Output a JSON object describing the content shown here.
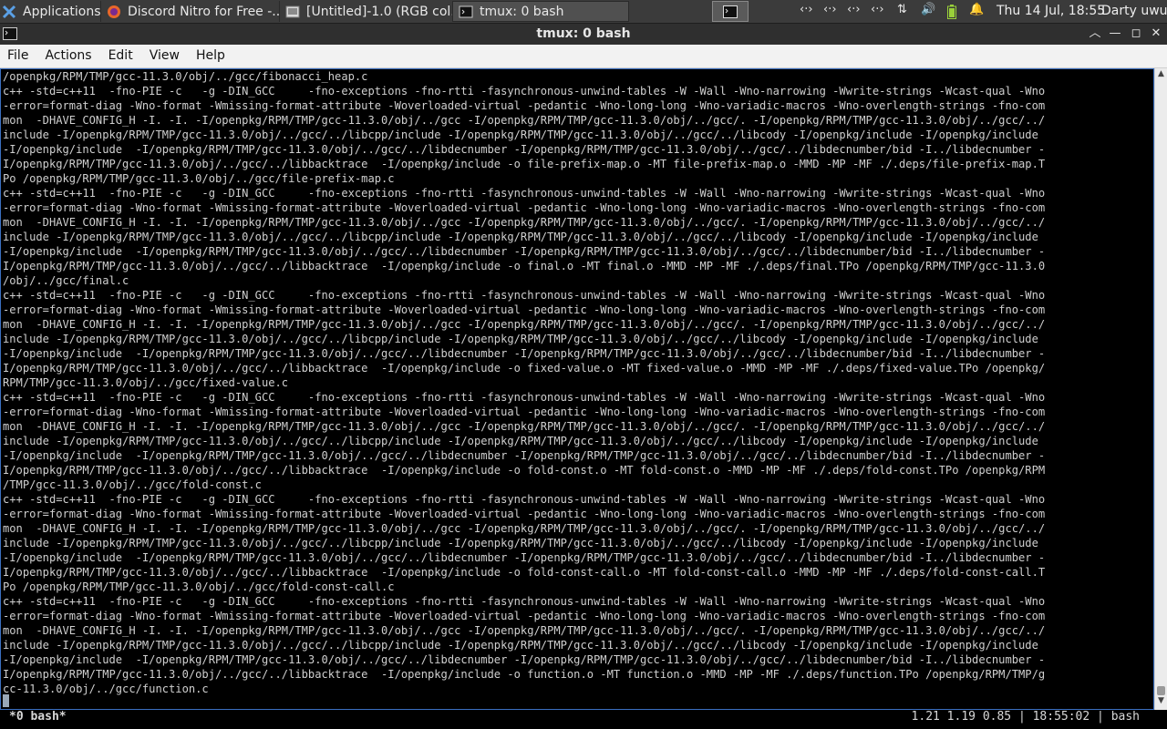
{
  "panel": {
    "apps_label": "Applications",
    "tasks": [
      {
        "label": "Discord Nitro for Free -..."
      },
      {
        "label": "[Untitled]-1.0 (RGB col..."
      },
      {
        "label": "tmux: 0 bash"
      }
    ],
    "tray_icons": [
      "network-icon",
      "network-icon",
      "network-icon",
      "network-icon",
      "transfer-icon",
      "volume-icon",
      "battery-icon",
      "bell-icon"
    ],
    "clock": "Thu 14 Jul, 18:55",
    "user": "Darty uwu"
  },
  "window": {
    "title": "tmux: 0 bash"
  },
  "menubar": {
    "items": [
      "File",
      "Actions",
      "Edit",
      "View",
      "Help"
    ]
  },
  "terminal": {
    "lines": [
      "/openpkg/RPM/TMP/gcc-11.3.0/obj/../gcc/fibonacci_heap.c",
      "c++ -std=c++11  -fno-PIE -c   -g -DIN_GCC     -fno-exceptions -fno-rtti -fasynchronous-unwind-tables -W -Wall -Wno-narrowing -Wwrite-strings -Wcast-qual -Wno",
      "-error=format-diag -Wno-format -Wmissing-format-attribute -Woverloaded-virtual -pedantic -Wno-long-long -Wno-variadic-macros -Wno-overlength-strings -fno-com",
      "mon  -DHAVE_CONFIG_H -I. -I. -I/openpkg/RPM/TMP/gcc-11.3.0/obj/../gcc -I/openpkg/RPM/TMP/gcc-11.3.0/obj/../gcc/. -I/openpkg/RPM/TMP/gcc-11.3.0/obj/../gcc/../",
      "include -I/openpkg/RPM/TMP/gcc-11.3.0/obj/../gcc/../libcpp/include -I/openpkg/RPM/TMP/gcc-11.3.0/obj/../gcc/../libcody -I/openpkg/include -I/openpkg/include",
      "-I/openpkg/include  -I/openpkg/RPM/TMP/gcc-11.3.0/obj/../gcc/../libdecnumber -I/openpkg/RPM/TMP/gcc-11.3.0/obj/../gcc/../libdecnumber/bid -I../libdecnumber -",
      "I/openpkg/RPM/TMP/gcc-11.3.0/obj/../gcc/../libbacktrace  -I/openpkg/include -o file-prefix-map.o -MT file-prefix-map.o -MMD -MP -MF ./.deps/file-prefix-map.T",
      "Po /openpkg/RPM/TMP/gcc-11.3.0/obj/../gcc/file-prefix-map.c",
      "c++ -std=c++11  -fno-PIE -c   -g -DIN_GCC     -fno-exceptions -fno-rtti -fasynchronous-unwind-tables -W -Wall -Wno-narrowing -Wwrite-strings -Wcast-qual -Wno",
      "-error=format-diag -Wno-format -Wmissing-format-attribute -Woverloaded-virtual -pedantic -Wno-long-long -Wno-variadic-macros -Wno-overlength-strings -fno-com",
      "mon  -DHAVE_CONFIG_H -I. -I. -I/openpkg/RPM/TMP/gcc-11.3.0/obj/../gcc -I/openpkg/RPM/TMP/gcc-11.3.0/obj/../gcc/. -I/openpkg/RPM/TMP/gcc-11.3.0/obj/../gcc/../",
      "include -I/openpkg/RPM/TMP/gcc-11.3.0/obj/../gcc/../libcpp/include -I/openpkg/RPM/TMP/gcc-11.3.0/obj/../gcc/../libcody -I/openpkg/include -I/openpkg/include",
      "-I/openpkg/include  -I/openpkg/RPM/TMP/gcc-11.3.0/obj/../gcc/../libdecnumber -I/openpkg/RPM/TMP/gcc-11.3.0/obj/../gcc/../libdecnumber/bid -I../libdecnumber -",
      "I/openpkg/RPM/TMP/gcc-11.3.0/obj/../gcc/../libbacktrace  -I/openpkg/include -o final.o -MT final.o -MMD -MP -MF ./.deps/final.TPo /openpkg/RPM/TMP/gcc-11.3.0",
      "/obj/../gcc/final.c",
      "c++ -std=c++11  -fno-PIE -c   -g -DIN_GCC     -fno-exceptions -fno-rtti -fasynchronous-unwind-tables -W -Wall -Wno-narrowing -Wwrite-strings -Wcast-qual -Wno",
      "-error=format-diag -Wno-format -Wmissing-format-attribute -Woverloaded-virtual -pedantic -Wno-long-long -Wno-variadic-macros -Wno-overlength-strings -fno-com",
      "mon  -DHAVE_CONFIG_H -I. -I. -I/openpkg/RPM/TMP/gcc-11.3.0/obj/../gcc -I/openpkg/RPM/TMP/gcc-11.3.0/obj/../gcc/. -I/openpkg/RPM/TMP/gcc-11.3.0/obj/../gcc/../",
      "include -I/openpkg/RPM/TMP/gcc-11.3.0/obj/../gcc/../libcpp/include -I/openpkg/RPM/TMP/gcc-11.3.0/obj/../gcc/../libcody -I/openpkg/include -I/openpkg/include",
      "-I/openpkg/include  -I/openpkg/RPM/TMP/gcc-11.3.0/obj/../gcc/../libdecnumber -I/openpkg/RPM/TMP/gcc-11.3.0/obj/../gcc/../libdecnumber/bid -I../libdecnumber -",
      "I/openpkg/RPM/TMP/gcc-11.3.0/obj/../gcc/../libbacktrace  -I/openpkg/include -o fixed-value.o -MT fixed-value.o -MMD -MP -MF ./.deps/fixed-value.TPo /openpkg/",
      "RPM/TMP/gcc-11.3.0/obj/../gcc/fixed-value.c",
      "c++ -std=c++11  -fno-PIE -c   -g -DIN_GCC     -fno-exceptions -fno-rtti -fasynchronous-unwind-tables -W -Wall -Wno-narrowing -Wwrite-strings -Wcast-qual -Wno",
      "-error=format-diag -Wno-format -Wmissing-format-attribute -Woverloaded-virtual -pedantic -Wno-long-long -Wno-variadic-macros -Wno-overlength-strings -fno-com",
      "mon  -DHAVE_CONFIG_H -I. -I. -I/openpkg/RPM/TMP/gcc-11.3.0/obj/../gcc -I/openpkg/RPM/TMP/gcc-11.3.0/obj/../gcc/. -I/openpkg/RPM/TMP/gcc-11.3.0/obj/../gcc/../",
      "include -I/openpkg/RPM/TMP/gcc-11.3.0/obj/../gcc/../libcpp/include -I/openpkg/RPM/TMP/gcc-11.3.0/obj/../gcc/../libcody -I/openpkg/include -I/openpkg/include",
      "-I/openpkg/include  -I/openpkg/RPM/TMP/gcc-11.3.0/obj/../gcc/../libdecnumber -I/openpkg/RPM/TMP/gcc-11.3.0/obj/../gcc/../libdecnumber/bid -I../libdecnumber -",
      "I/openpkg/RPM/TMP/gcc-11.3.0/obj/../gcc/../libbacktrace  -I/openpkg/include -o fold-const.o -MT fold-const.o -MMD -MP -MF ./.deps/fold-const.TPo /openpkg/RPM",
      "/TMP/gcc-11.3.0/obj/../gcc/fold-const.c",
      "c++ -std=c++11  -fno-PIE -c   -g -DIN_GCC     -fno-exceptions -fno-rtti -fasynchronous-unwind-tables -W -Wall -Wno-narrowing -Wwrite-strings -Wcast-qual -Wno",
      "-error=format-diag -Wno-format -Wmissing-format-attribute -Woverloaded-virtual -pedantic -Wno-long-long -Wno-variadic-macros -Wno-overlength-strings -fno-com",
      "mon  -DHAVE_CONFIG_H -I. -I. -I/openpkg/RPM/TMP/gcc-11.3.0/obj/../gcc -I/openpkg/RPM/TMP/gcc-11.3.0/obj/../gcc/. -I/openpkg/RPM/TMP/gcc-11.3.0/obj/../gcc/../",
      "include -I/openpkg/RPM/TMP/gcc-11.3.0/obj/../gcc/../libcpp/include -I/openpkg/RPM/TMP/gcc-11.3.0/obj/../gcc/../libcody -I/openpkg/include -I/openpkg/include",
      "-I/openpkg/include  -I/openpkg/RPM/TMP/gcc-11.3.0/obj/../gcc/../libdecnumber -I/openpkg/RPM/TMP/gcc-11.3.0/obj/../gcc/../libdecnumber/bid -I../libdecnumber -",
      "I/openpkg/RPM/TMP/gcc-11.3.0/obj/../gcc/../libbacktrace  -I/openpkg/include -o fold-const-call.o -MT fold-const-call.o -MMD -MP -MF ./.deps/fold-const-call.T",
      "Po /openpkg/RPM/TMP/gcc-11.3.0/obj/../gcc/fold-const-call.c",
      "c++ -std=c++11  -fno-PIE -c   -g -DIN_GCC     -fno-exceptions -fno-rtti -fasynchronous-unwind-tables -W -Wall -Wno-narrowing -Wwrite-strings -Wcast-qual -Wno",
      "-error=format-diag -Wno-format -Wmissing-format-attribute -Woverloaded-virtual -pedantic -Wno-long-long -Wno-variadic-macros -Wno-overlength-strings -fno-com",
      "mon  -DHAVE_CONFIG_H -I. -I. -I/openpkg/RPM/TMP/gcc-11.3.0/obj/../gcc -I/openpkg/RPM/TMP/gcc-11.3.0/obj/../gcc/. -I/openpkg/RPM/TMP/gcc-11.3.0/obj/../gcc/../",
      "include -I/openpkg/RPM/TMP/gcc-11.3.0/obj/../gcc/../libcpp/include -I/openpkg/RPM/TMP/gcc-11.3.0/obj/../gcc/../libcody -I/openpkg/include -I/openpkg/include",
      "-I/openpkg/include  -I/openpkg/RPM/TMP/gcc-11.3.0/obj/../gcc/../libdecnumber -I/openpkg/RPM/TMP/gcc-11.3.0/obj/../gcc/../libdecnumber/bid -I../libdecnumber -",
      "I/openpkg/RPM/TMP/gcc-11.3.0/obj/../gcc/../libbacktrace  -I/openpkg/include -o function.o -MT function.o -MMD -MP -MF ./.deps/function.TPo /openpkg/RPM/TMP/g",
      "cc-11.3.0/obj/../gcc/function.c"
    ]
  },
  "tmux_status": {
    "window": "*0 bash*",
    "right": "1.21 1.19 0.85 | 18:55:02 | bash"
  }
}
